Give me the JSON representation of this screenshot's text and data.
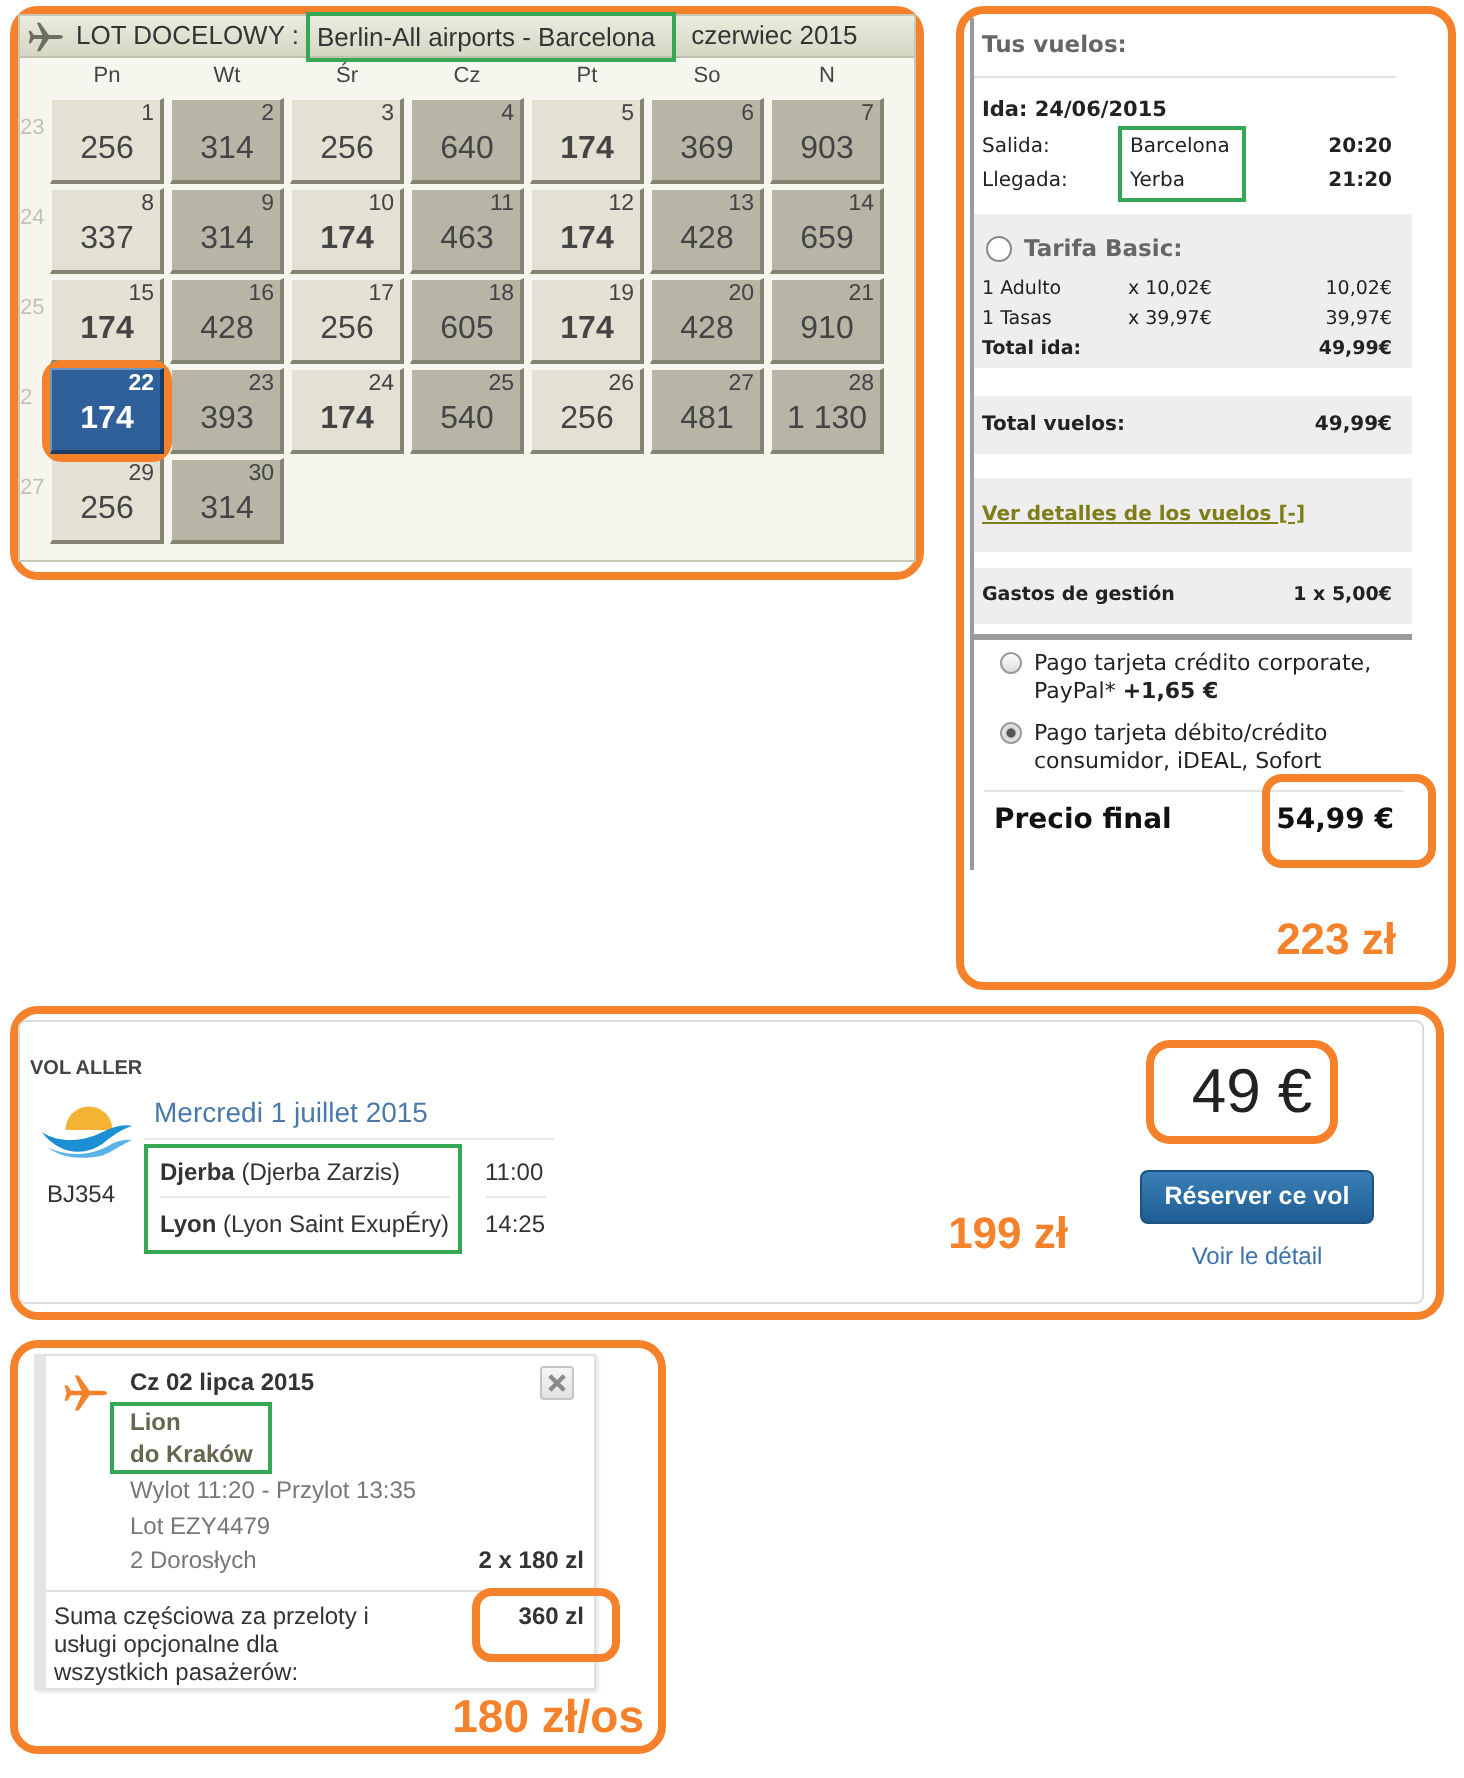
{
  "calendar": {
    "title": "LOT DOCELOWY :",
    "route": {
      "text": "Berlin-All airports - Barcelona",
      "highlighted": true
    },
    "month": "czerwiec 2015",
    "weekdays": [
      {
        "label": "Pn",
        "shaded": false
      },
      {
        "label": "Wt",
        "shaded": true
      },
      {
        "label": "Śr",
        "shaded": false
      },
      {
        "label": "Cz",
        "shaded": true
      },
      {
        "label": "Pt",
        "shaded": false
      },
      {
        "label": "So",
        "shaded": true
      },
      {
        "label": "N",
        "shaded": true
      }
    ],
    "weeks": [
      {
        "number": "23",
        "days": [
          {
            "day": "1",
            "price": "256",
            "cheapest": false,
            "selected": false,
            "circled": false
          },
          {
            "day": "2",
            "price": "314",
            "cheapest": false,
            "selected": false,
            "circled": false
          },
          {
            "day": "3",
            "price": "256",
            "cheapest": false,
            "selected": false,
            "circled": false
          },
          {
            "day": "4",
            "price": "640",
            "cheapest": false,
            "selected": false,
            "circled": false
          },
          {
            "day": "5",
            "price": "174",
            "cheapest": true,
            "selected": false,
            "circled": false
          },
          {
            "day": "6",
            "price": "369",
            "cheapest": false,
            "selected": false,
            "circled": false
          },
          {
            "day": "7",
            "price": "903",
            "cheapest": false,
            "selected": false,
            "circled": false
          }
        ]
      },
      {
        "number": "24",
        "days": [
          {
            "day": "8",
            "price": "337",
            "cheapest": false,
            "selected": false,
            "circled": false
          },
          {
            "day": "9",
            "price": "314",
            "cheapest": false,
            "selected": false,
            "circled": false
          },
          {
            "day": "10",
            "price": "174",
            "cheapest": true,
            "selected": false,
            "circled": false
          },
          {
            "day": "11",
            "price": "463",
            "cheapest": false,
            "selected": false,
            "circled": false
          },
          {
            "day": "12",
            "price": "174",
            "cheapest": true,
            "selected": false,
            "circled": false
          },
          {
            "day": "13",
            "price": "428",
            "cheapest": false,
            "selected": false,
            "circled": false
          },
          {
            "day": "14",
            "price": "659",
            "cheapest": false,
            "selected": false,
            "circled": false
          }
        ]
      },
      {
        "number": "25",
        "days": [
          {
            "day": "15",
            "price": "174",
            "cheapest": true,
            "selected": false,
            "circled": false
          },
          {
            "day": "16",
            "price": "428",
            "cheapest": false,
            "selected": false,
            "circled": false
          },
          {
            "day": "17",
            "price": "256",
            "cheapest": false,
            "selected": false,
            "circled": false
          },
          {
            "day": "18",
            "price": "605",
            "cheapest": false,
            "selected": false,
            "circled": false
          },
          {
            "day": "19",
            "price": "174",
            "cheapest": true,
            "selected": false,
            "circled": false
          },
          {
            "day": "20",
            "price": "428",
            "cheapest": false,
            "selected": false,
            "circled": false
          },
          {
            "day": "21",
            "price": "910",
            "cheapest": false,
            "selected": false,
            "circled": false
          }
        ]
      },
      {
        "number": "2",
        "days": [
          {
            "day": "22",
            "price": "174",
            "cheapest": true,
            "selected": true,
            "circled": true
          },
          {
            "day": "23",
            "price": "393",
            "cheapest": false,
            "selected": false,
            "circled": false
          },
          {
            "day": "24",
            "price": "174",
            "cheapest": true,
            "selected": false,
            "circled": false
          },
          {
            "day": "25",
            "price": "540",
            "cheapest": false,
            "selected": false,
            "circled": false
          },
          {
            "day": "26",
            "price": "256",
            "cheapest": false,
            "selected": false,
            "circled": false
          },
          {
            "day": "27",
            "price": "481",
            "cheapest": false,
            "selected": false,
            "circled": false
          },
          {
            "day": "28",
            "price": "1 130",
            "cheapest": false,
            "selected": false,
            "circled": false
          }
        ]
      },
      {
        "number": "27",
        "days": [
          {
            "day": "29",
            "price": "256",
            "cheapest": false,
            "selected": false,
            "circled": false
          },
          {
            "day": "30",
            "price": "314",
            "cheapest": false,
            "selected": false,
            "circled": false
          }
        ]
      }
    ]
  },
  "booking_summary": {
    "title": "Tus vuelos:",
    "flight_date": "Ida: 24/06/2015",
    "legs": [
      {
        "label": "Salida:",
        "place": "Barcelona",
        "time": "20:20"
      },
      {
        "label": "Llegada:",
        "place": "Yerba",
        "time": "21:20"
      }
    ],
    "places_highlighted": true,
    "fare": {
      "name": "Tarifa Basic:",
      "checked": false,
      "lines": [
        {
          "item": "1 Adulto",
          "unit": "x 10,02€",
          "amount": "10,02€"
        },
        {
          "item": "1 Tasas",
          "unit": "x 39,97€",
          "amount": "39,97€"
        }
      ],
      "total_label": "Total ida:",
      "total": "49,99€"
    },
    "flights_total": {
      "label": "Total vuelos:",
      "value": "49,99€"
    },
    "details_link": "Ver detalles de los vuelos [-]",
    "fee": {
      "label": "Gastos de gestión",
      "value": "1 x 5,00€"
    },
    "payment_options": [
      {
        "text": "Pago tarjeta crédito corporate, PayPal* **+1,65 €**",
        "selected": false
      },
      {
        "text": "Pago tarjeta débito/crédito consumidor, iDEAL, Sofort",
        "selected": true
      }
    ],
    "final_price": {
      "label": "Precio final",
      "value": "54,99 €",
      "highlighted": true
    },
    "note": "223 zł"
  },
  "flight_offer": {
    "heading": "VOL ALLER",
    "flight_number": "BJ354",
    "date": "Mercredi 1 juillet 2015",
    "stops": [
      {
        "place": "**Djerba** (Djerba Zarzis)",
        "time": "11:00"
      },
      {
        "place": "**Lyon** (Lyon Saint ExupÉry)",
        "time": "14:25"
      }
    ],
    "places_highlighted": true,
    "note": "199 zł",
    "price": {
      "text": "49 €",
      "highlighted": true
    },
    "book_button": "Réserver ce vol",
    "details_link": "Voir le détail"
  },
  "flight_card": {
    "date": "Cz 02 lipca 2015",
    "route": [
      "Lion",
      "do Kraków"
    ],
    "route_highlighted": true,
    "times": "Wylot 11:20 - Przylot 13:35",
    "flight": "Lot EZY4479",
    "passengers": "2 Dorosłych",
    "fare": "2 x 180 zl",
    "subtotal_label": "Suma częściowa za przeloty i usługi opcjonalne dla wszystkich pasażerów:",
    "subtotal": {
      "text": "360 zl",
      "highlighted": true
    },
    "note": "180 zł/os"
  }
}
